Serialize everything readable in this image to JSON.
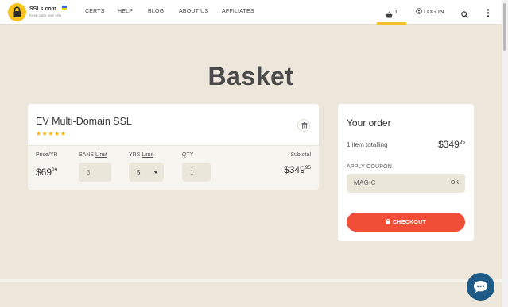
{
  "header": {
    "logo_name": "SSLs.com",
    "logo_tagline": "Keep calm, use ssls",
    "nav": [
      "CERTS",
      "HELP",
      "BLOG",
      "ABOUT US",
      "AFFILIATES"
    ],
    "basket_count": "1",
    "login_label": "LOG IN"
  },
  "page_title": "Basket",
  "product": {
    "name": "EV Multi-Domain SSL",
    "rating": "★★★★★",
    "price_label": "Price/YR",
    "price_main": "$69",
    "price_cents": "99",
    "sans_label": "SANS",
    "sans_limit": "Limit",
    "sans_value": "3",
    "yrs_label": "YRS",
    "yrs_limit": "Limit",
    "yrs_value": "5",
    "qty_label": "QTY",
    "qty_value": "1",
    "subtotal_label": "Subtotal",
    "subtotal_main": "$349",
    "subtotal_cents": "95"
  },
  "order": {
    "title": "Your order",
    "items_text": "1 item totalling",
    "total_main": "$349",
    "total_cents": "95",
    "coupon_label": "APPLY COUPON",
    "coupon_value": "MAGIC",
    "coupon_ok": "OK",
    "checkout_label": "CHECKOUT"
  },
  "colors": {
    "background": "#ece7da",
    "accent_yellow": "#f2c02e",
    "checkout_red": "#f04e37",
    "chat_blue": "#1e5a86"
  }
}
